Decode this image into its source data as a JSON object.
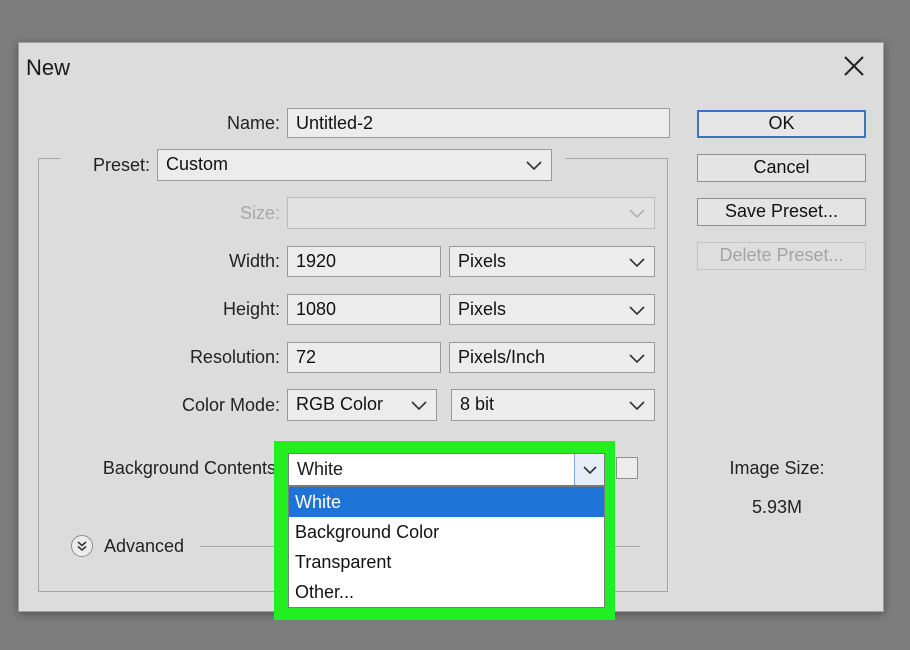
{
  "dialog": {
    "title": "New",
    "name_label": "Name:",
    "name_value": "Untitled-2",
    "preset_label": "Preset:",
    "preset_value": "Custom",
    "size_label": "Size:",
    "size_value": "",
    "width_label": "Width:",
    "width_value": "1920",
    "width_unit": "Pixels",
    "height_label": "Height:",
    "height_value": "1080",
    "height_unit": "Pixels",
    "resolution_label": "Resolution:",
    "resolution_value": "72",
    "resolution_unit": "Pixels/Inch",
    "color_mode_label": "Color Mode:",
    "color_mode_value": "RGB Color",
    "bit_depth_value": "8 bit",
    "background_label": "Background Contents",
    "background_value": "White",
    "background_options": [
      "White",
      "Background Color",
      "Transparent",
      "Other..."
    ],
    "advanced_label": "Advanced",
    "image_size_label": "Image Size:",
    "image_size_value": "5.93M"
  },
  "buttons": {
    "ok": "OK",
    "cancel": "Cancel",
    "save_preset": "Save Preset...",
    "delete_preset": "Delete Preset..."
  },
  "colors": {
    "highlight": "#22ee22",
    "selection": "#1e73d6",
    "primary_border": "#3a76c4",
    "dialog_bg": "#dcdcdc"
  }
}
